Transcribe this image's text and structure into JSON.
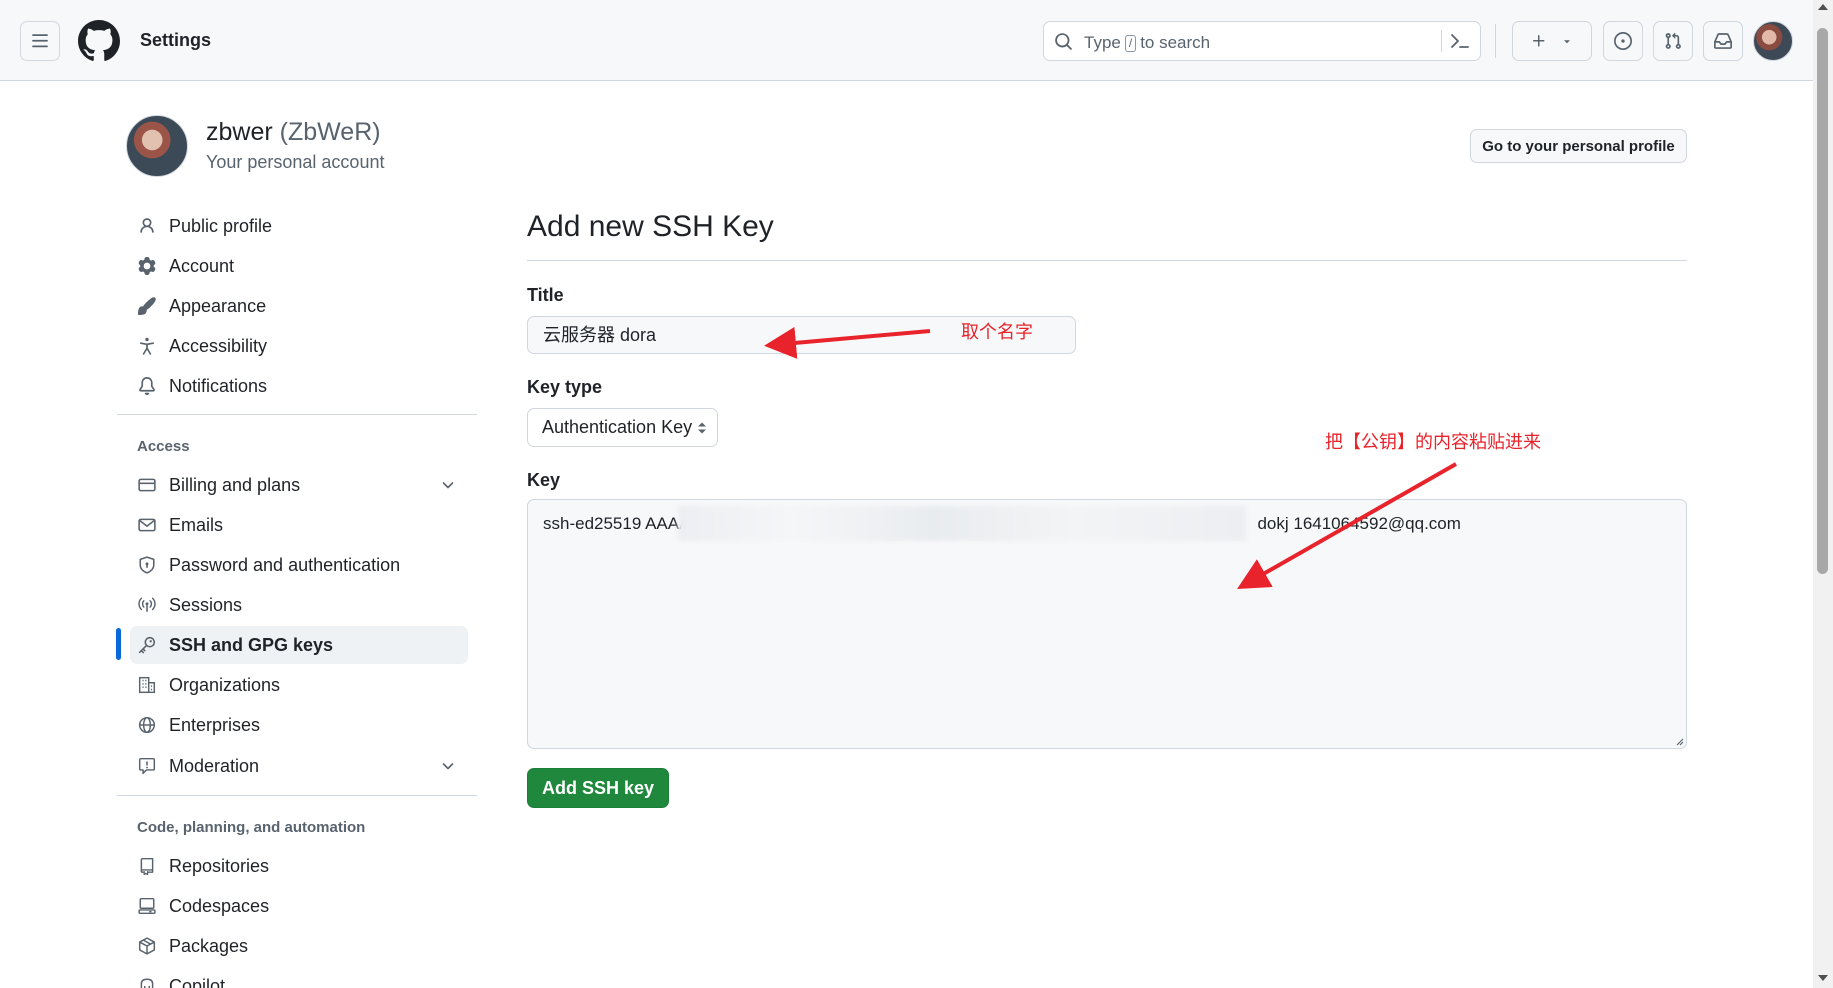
{
  "header": {
    "context_title": "Settings",
    "search_prefix": "Type",
    "search_key": "/",
    "search_suffix": "to search",
    "icons": [
      "menu-icon",
      "github-logo",
      "search-icon",
      "command-palette-icon",
      "plus-icon",
      "triangle-down-icon",
      "issue-icon",
      "pull-request-icon",
      "inbox-icon"
    ]
  },
  "user": {
    "name": "zbwer",
    "login": "(ZbWeR)",
    "subtitle": "Your personal account",
    "profile_button": "Go to your personal profile"
  },
  "sidebar": {
    "group1": [
      {
        "label": "Public profile",
        "icon": "person-icon"
      },
      {
        "label": "Account",
        "icon": "gear-icon"
      },
      {
        "label": "Appearance",
        "icon": "paintbrush-icon"
      },
      {
        "label": "Accessibility",
        "icon": "accessibility-icon"
      },
      {
        "label": "Notifications",
        "icon": "bell-icon"
      }
    ],
    "access_heading": "Access",
    "access": [
      {
        "label": "Billing and plans",
        "icon": "credit-card-icon"
      },
      {
        "label": "Emails",
        "icon": "mail-icon"
      },
      {
        "label": "Password and authentication",
        "icon": "shield-lock-icon"
      },
      {
        "label": "Sessions",
        "icon": "broadcast-icon"
      },
      {
        "label": "SSH and GPG keys",
        "icon": "key-icon"
      },
      {
        "label": "Organizations",
        "icon": "organization-icon"
      },
      {
        "label": "Enterprises",
        "icon": "globe-icon"
      },
      {
        "label": "Moderation",
        "icon": "report-icon"
      }
    ],
    "code_heading": "Code, planning, and automation",
    "code": [
      {
        "label": "Repositories",
        "icon": "repo-icon"
      },
      {
        "label": "Codespaces",
        "icon": "codespaces-icon"
      },
      {
        "label": "Packages",
        "icon": "package-icon"
      },
      {
        "label": "Copilot",
        "icon": "copilot-icon"
      }
    ]
  },
  "form": {
    "page_title": "Add new SSH Key",
    "title_label": "Title",
    "title_value": "云服务器 dora",
    "keytype_label": "Key type",
    "keytype_value": "Authentication Key",
    "key_label": "Key",
    "key_prefix": "ssh-ed25519 AAAA",
    "key_suffix": "dokj 1641064592@qq.com",
    "submit_label": "Add SSH key"
  },
  "annotations": {
    "title_note": "取个名字",
    "key_note": "把【公钥】的内容粘贴进来",
    "color": "#e8232b"
  }
}
